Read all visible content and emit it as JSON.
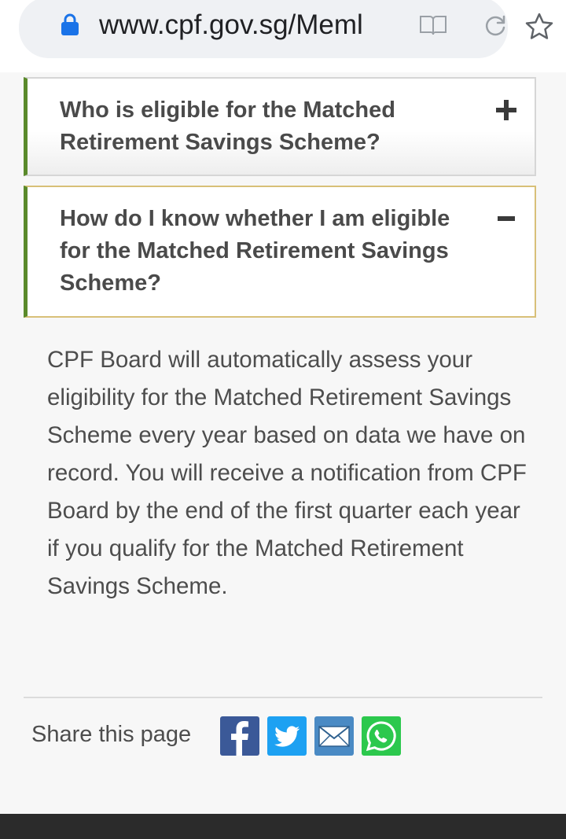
{
  "browser": {
    "url": "www.cpf.gov.sg/Meml",
    "lock_icon": "lock-icon",
    "reader_icon": "reader-mode-icon",
    "reload_icon": "reload-icon",
    "bookmark_icon": "star-icon"
  },
  "faq": {
    "items": [
      {
        "question": "Who is eligible for the Matched Retirement Savings Scheme?",
        "expanded": false,
        "toggle_icon": "plus-icon"
      },
      {
        "question": "How do I know whether I am eligible for the Matched Retirement Savings Scheme?",
        "expanded": true,
        "toggle_icon": "minus-icon",
        "answer": "CPF Board will automatically assess your eligibility for the Matched Retirement Savings Scheme every year based on data we have on record. You will receive a notification from CPF Board by the end of the first quarter each year if you qualify for the Matched Retirement Savings Scheme."
      }
    ]
  },
  "share": {
    "label": "Share this page",
    "buttons": [
      {
        "icon": "facebook-icon",
        "color": "#3b5998"
      },
      {
        "icon": "twitter-icon",
        "color": "#1da1f2"
      },
      {
        "icon": "email-icon",
        "color": "#4a8ac4"
      },
      {
        "icon": "whatsapp-icon",
        "color": "#2cc84d"
      }
    ]
  },
  "colors": {
    "accent_border": "#5a8a2b",
    "expanded_border": "#d8c078",
    "question_text": "#4a4a4a",
    "body_text": "#4d4d4d",
    "footer": "#2b2b2b"
  }
}
